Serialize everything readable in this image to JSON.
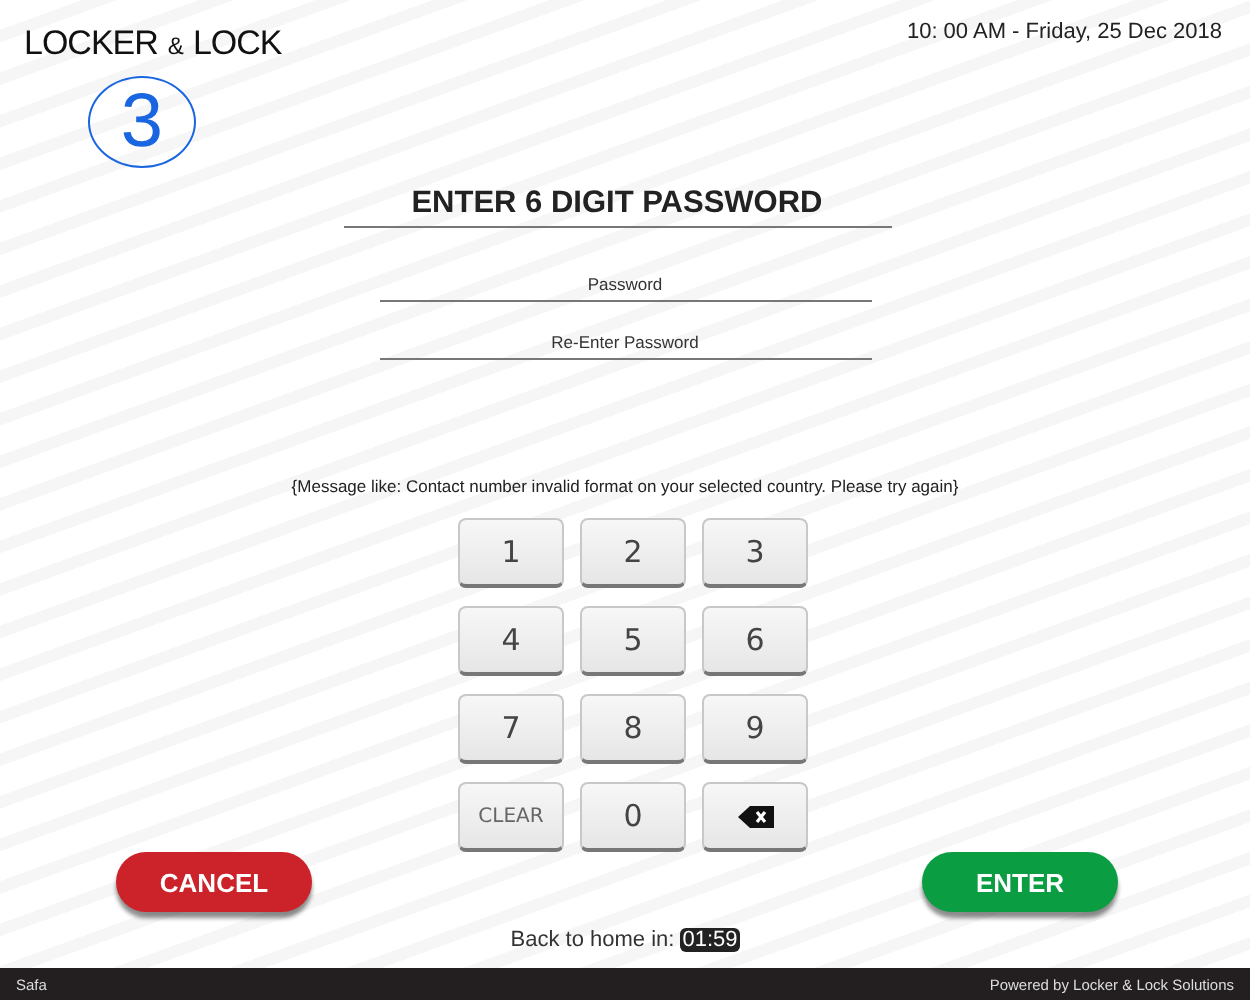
{
  "brand": {
    "parts": [
      "LOCKER",
      "&",
      "LOCK"
    ]
  },
  "datetime": "10: 00 AM - Friday, 25 Dec 2018",
  "step": "3",
  "title": "ENTER 6 DIGIT PASSWORD",
  "fields": [
    {
      "placeholder": "Password"
    },
    {
      "placeholder": "Re-Enter Password"
    }
  ],
  "message": "{Message like: Contact number invalid format on your selected country. Please try again}",
  "keypad": [
    {
      "kind": "digit",
      "label": "1"
    },
    {
      "kind": "digit",
      "label": "2"
    },
    {
      "kind": "digit",
      "label": "3"
    },
    {
      "kind": "digit",
      "label": "4"
    },
    {
      "kind": "digit",
      "label": "5"
    },
    {
      "kind": "digit",
      "label": "6"
    },
    {
      "kind": "digit",
      "label": "7"
    },
    {
      "kind": "digit",
      "label": "8"
    },
    {
      "kind": "digit",
      "label": "9"
    },
    {
      "kind": "clear",
      "label": "CLEAR"
    },
    {
      "kind": "digit",
      "label": "0"
    },
    {
      "kind": "backspace"
    }
  ],
  "buttons": [
    {
      "kind": "cancel",
      "label": "CANCEL"
    },
    {
      "kind": "enter",
      "label": "ENTER"
    }
  ],
  "countdown": {
    "label": "Back to home in:",
    "time": "01:59"
  },
  "footer": {
    "user": "Safa",
    "credit": "Powered by Locker & Lock Solutions"
  }
}
